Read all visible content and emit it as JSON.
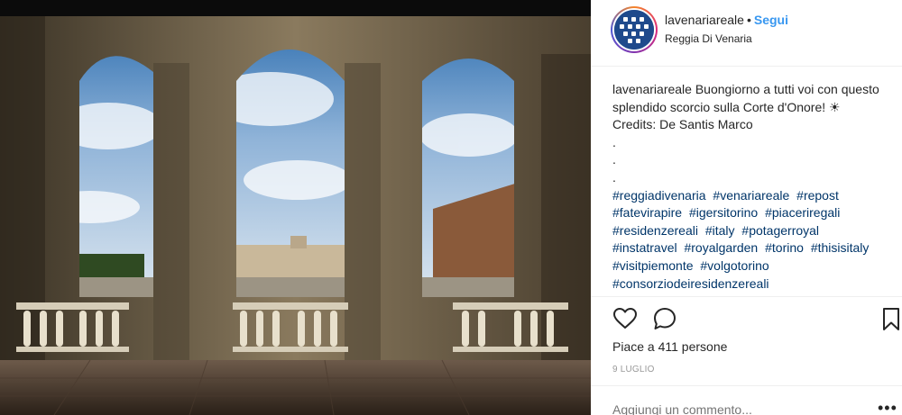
{
  "post": {
    "username": "lavenariareale",
    "separator": "•",
    "follow_label": "Segui",
    "location": "Reggia Di Venaria"
  },
  "caption": {
    "username": "lavenariareale",
    "text": "Buongiorno a tutti voi con questo splendido scorcio sulla Corte d'Onore! ☀",
    "credits": "Credits: De Santis Marco",
    "dots": [
      ".",
      ".",
      "."
    ],
    "hashtags": [
      "#reggiadivenaria",
      "#venariareale",
      "#repost",
      "#fatevirapire",
      "#igersitorino",
      "#piaceriregali",
      "#residenzereali",
      "#italy",
      "#potagerroyal",
      "#instatravel",
      "#royalgarden",
      "#torino",
      "#thisisitaly",
      "#visitpiemonte",
      "#volgotorino",
      "#consorziodeiresidenzereali"
    ]
  },
  "actions": {
    "like_icon": "heart-icon",
    "comment_icon": "comment-icon",
    "save_icon": "bookmark-icon"
  },
  "likes_text": "Piace a 411 persone",
  "date_text": "9 LUGLIO",
  "comment_placeholder": "Aggiungi un commento...",
  "colors": {
    "follow": "#3897f0",
    "hashtag": "#003569",
    "muted": "#999999",
    "text": "#262626"
  }
}
